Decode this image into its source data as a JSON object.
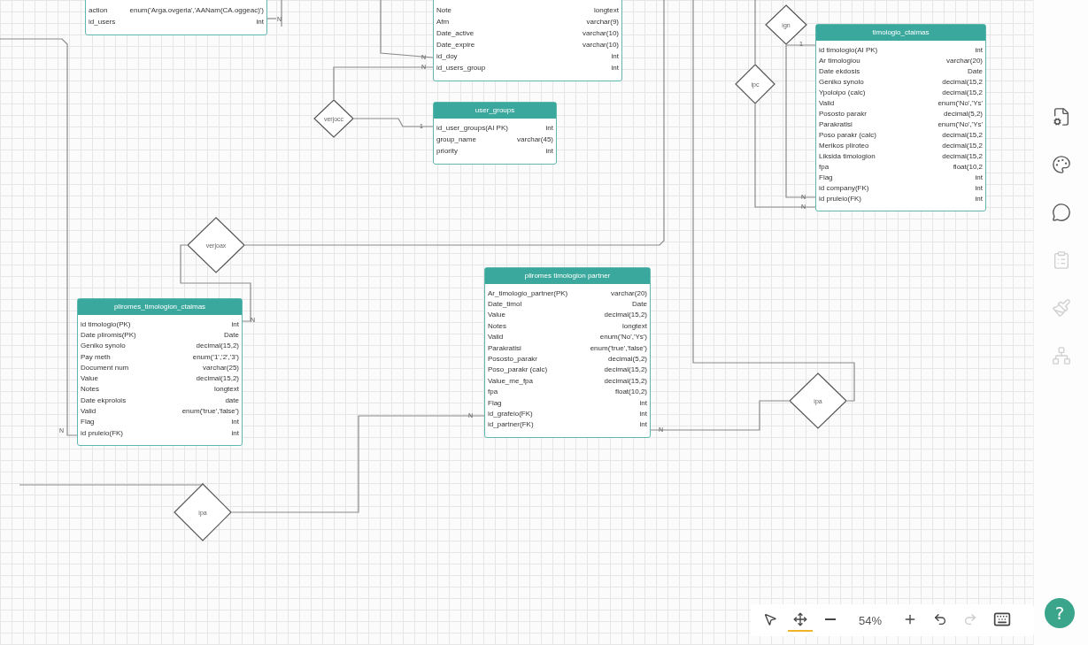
{
  "tables": [
    {
      "rows": [
        {
          "name": "action",
          "type": "enum('Arga.ovgeria','AANam(CA.oggeac)')"
        },
        {
          "name": "id_users",
          "type": "int"
        }
      ]
    },
    {
      "rows": [
        {
          "name": "Note",
          "type": "longtext"
        },
        {
          "name": "Afm",
          "type": "varchar(9)"
        },
        {
          "name": "Date_active",
          "type": "varchar(10)"
        },
        {
          "name": "Date_expire",
          "type": "varchar(10)"
        },
        {
          "name": "id_doy",
          "type": "int"
        },
        {
          "name": "id_users_group",
          "type": "int"
        }
      ]
    },
    {
      "title": "user_groups",
      "rows": [
        {
          "name": "id_user_groups(AI PK)",
          "type": "int"
        },
        {
          "name": "group_name",
          "type": "varchar(45)"
        },
        {
          "name": "priority",
          "type": "int"
        }
      ]
    },
    {
      "title": "timologio_ctaimas",
      "rows": [
        {
          "name": "id timologio(AI PK)",
          "type": "int"
        },
        {
          "name": "Ar timologiou",
          "type": "varchar(20)"
        },
        {
          "name": "Date ekdosis",
          "type": "Date"
        },
        {
          "name": "Geniko synolo",
          "type": "decimal(15,2"
        },
        {
          "name": "Ypoloipo (calc)",
          "type": "decimal(15,2"
        },
        {
          "name": "Valid",
          "type": "enum('No','Ys'"
        },
        {
          "name": "Pososto parakr",
          "type": "decimal(5,2)"
        },
        {
          "name": "Parakratisi",
          "type": "enum('No','Ys'"
        },
        {
          "name": "Poso parakr (calc)",
          "type": "decimal(15,2"
        },
        {
          "name": "Merikos pliroteo",
          "type": "decimal(15,2"
        },
        {
          "name": "Liksida timologion",
          "type": "decimal(15,2"
        },
        {
          "name": "fpa",
          "type": "float(10,2"
        },
        {
          "name": "Flag",
          "type": "int"
        },
        {
          "name": "id company(FK)",
          "type": "int"
        },
        {
          "name": "id pruleio(FK)",
          "type": "int"
        }
      ]
    },
    {
      "title": "pliromes_timologion_ctaimas",
      "rows": [
        {
          "name": "id timologio(PK)",
          "type": "int"
        },
        {
          "name": "Date pliromis(PK)",
          "type": "Date"
        },
        {
          "name": "Geniko synolo",
          "type": "decimal(15,2)"
        },
        {
          "name": "Pay meth",
          "type": "enum('1','2','3')"
        },
        {
          "name": "Document num",
          "type": "varchar(25)"
        },
        {
          "name": "Value",
          "type": "decimal(15,2)"
        },
        {
          "name": "Notes",
          "type": "longtext"
        },
        {
          "name": "Date ekprolois",
          "type": "date"
        },
        {
          "name": "Valid",
          "type": "enum('true','false')"
        },
        {
          "name": "Flag",
          "type": "int"
        },
        {
          "name": "id pruleio(FK)",
          "type": "int"
        }
      ]
    },
    {
      "title": "pliromes timologion partner",
      "rows": [
        {
          "name": "Ar_timologio_partner(PK)",
          "type": "varchar(20)"
        },
        {
          "name": "Date_timol",
          "type": "Date"
        },
        {
          "name": "Value",
          "type": "decimal(15,2)"
        },
        {
          "name": "Notes",
          "type": "longtext"
        },
        {
          "name": "Valid",
          "type": "enum('No','Ys')"
        },
        {
          "name": "Parakratisi",
          "type": "enum('true','false')"
        },
        {
          "name": "Pososto_parakr",
          "type": "decimal(5,2)"
        },
        {
          "name": "Poso_parakr (calc)",
          "type": "decimal(15,2)"
        },
        {
          "name": "Value_me_fpa",
          "type": "decimal(15,2)"
        },
        {
          "name": "fpa",
          "type": "float(10,2)"
        },
        {
          "name": "Flag",
          "type": "int"
        },
        {
          "name": "id_grafeio(FK)",
          "type": "int"
        },
        {
          "name": "id_partner(FK)",
          "type": "int"
        }
      ]
    }
  ],
  "relationships": [
    {
      "label": "ign"
    },
    {
      "label": "ipc"
    },
    {
      "label": "verjocc"
    },
    {
      "label": "verjoax"
    },
    {
      "label": "ipa"
    },
    {
      "label": "ipa"
    }
  ],
  "cardinalities": [
    "N",
    "N",
    "N",
    "1",
    "N",
    "N",
    "N",
    "N",
    "1",
    "N",
    "N"
  ],
  "side_panel": [
    {
      "kind": "page-settings",
      "disabled": false
    },
    {
      "kind": "palette",
      "disabled": false
    },
    {
      "kind": "comment",
      "disabled": false
    },
    {
      "kind": "notes",
      "disabled": true
    },
    {
      "kind": "brush",
      "disabled": true
    },
    {
      "kind": "tree",
      "disabled": true
    }
  ],
  "toolbar": {
    "tools": [
      {
        "kind": "select",
        "selected": false
      },
      {
        "kind": "pan",
        "selected": true
      }
    ],
    "zoom": "54%",
    "undo": {
      "disabled": false
    },
    "redo": {
      "disabled": true
    }
  },
  "help": "?"
}
